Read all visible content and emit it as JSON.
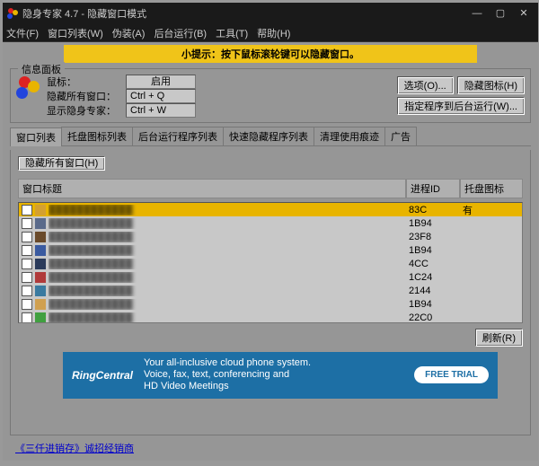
{
  "window": {
    "title": "隐身专家 4.7 - 隐藏窗口模式",
    "controls": {
      "min": "—",
      "max": "▢",
      "close": "✕"
    }
  },
  "menu": {
    "file": "文件(F)",
    "winlist": "窗口列表(W)",
    "disguise": "伪装(A)",
    "background": "后台运行(B)",
    "tools": "工具(T)",
    "help": "帮助(H)"
  },
  "tip": "小提示：按下鼠标滚轮键可以隐藏窗口。",
  "info": {
    "legend": "信息面板",
    "mouse_label": "鼠标：",
    "mouse_value": "启用",
    "hide_all_label": "隐藏所有窗口：",
    "hide_all_hk": "Ctrl + Q",
    "show_label": "显示隐身专家：",
    "show_hk": "Ctrl + W"
  },
  "buttons": {
    "options": "选项(O)...",
    "hide_icon": "隐藏图标(H)",
    "specify_bg": "指定程序到后台运行(W)...",
    "hide_all_windows": "隐藏所有窗口(H)",
    "refresh": "刷新(R)"
  },
  "tabs": {
    "winlist": "窗口列表",
    "traylist": "托盘图标列表",
    "bglist": "后台运行程序列表",
    "quicklist": "快速隐藏程序列表",
    "cleanup": "清理使用痕迹",
    "ads": "广告"
  },
  "columns": {
    "title": "窗口标题",
    "pid": "进程ID",
    "tray": "托盘图标"
  },
  "rows": [
    {
      "pid": "83C",
      "tray": "有",
      "selected": true,
      "ico": "#d4a030"
    },
    {
      "pid": "1B94",
      "tray": "",
      "ico": "#5a6a8a"
    },
    {
      "pid": "23F8",
      "tray": "",
      "ico": "#6a4a2a"
    },
    {
      "pid": "1B94",
      "tray": "",
      "ico": "#3a5aa0"
    },
    {
      "pid": "4CC",
      "tray": "",
      "ico": "#2a3a5a"
    },
    {
      "pid": "1C24",
      "tray": "",
      "ico": "#b03a3a"
    },
    {
      "pid": "2144",
      "tray": "",
      "ico": "#3a7aa0"
    },
    {
      "pid": "1B94",
      "tray": "",
      "ico": "#d0a050"
    },
    {
      "pid": "22C0",
      "tray": "",
      "ico": "#40a040"
    }
  ],
  "ad": {
    "brand": "RingCentral",
    "line1": "Your all-inclusive cloud phone system.",
    "line2": "Voice, fax, text, conferencing and",
    "line3": "HD Video Meetings",
    "cta": "FREE TRIAL"
  },
  "footer": {
    "link": "《三仟进销存》诚招经销商"
  }
}
